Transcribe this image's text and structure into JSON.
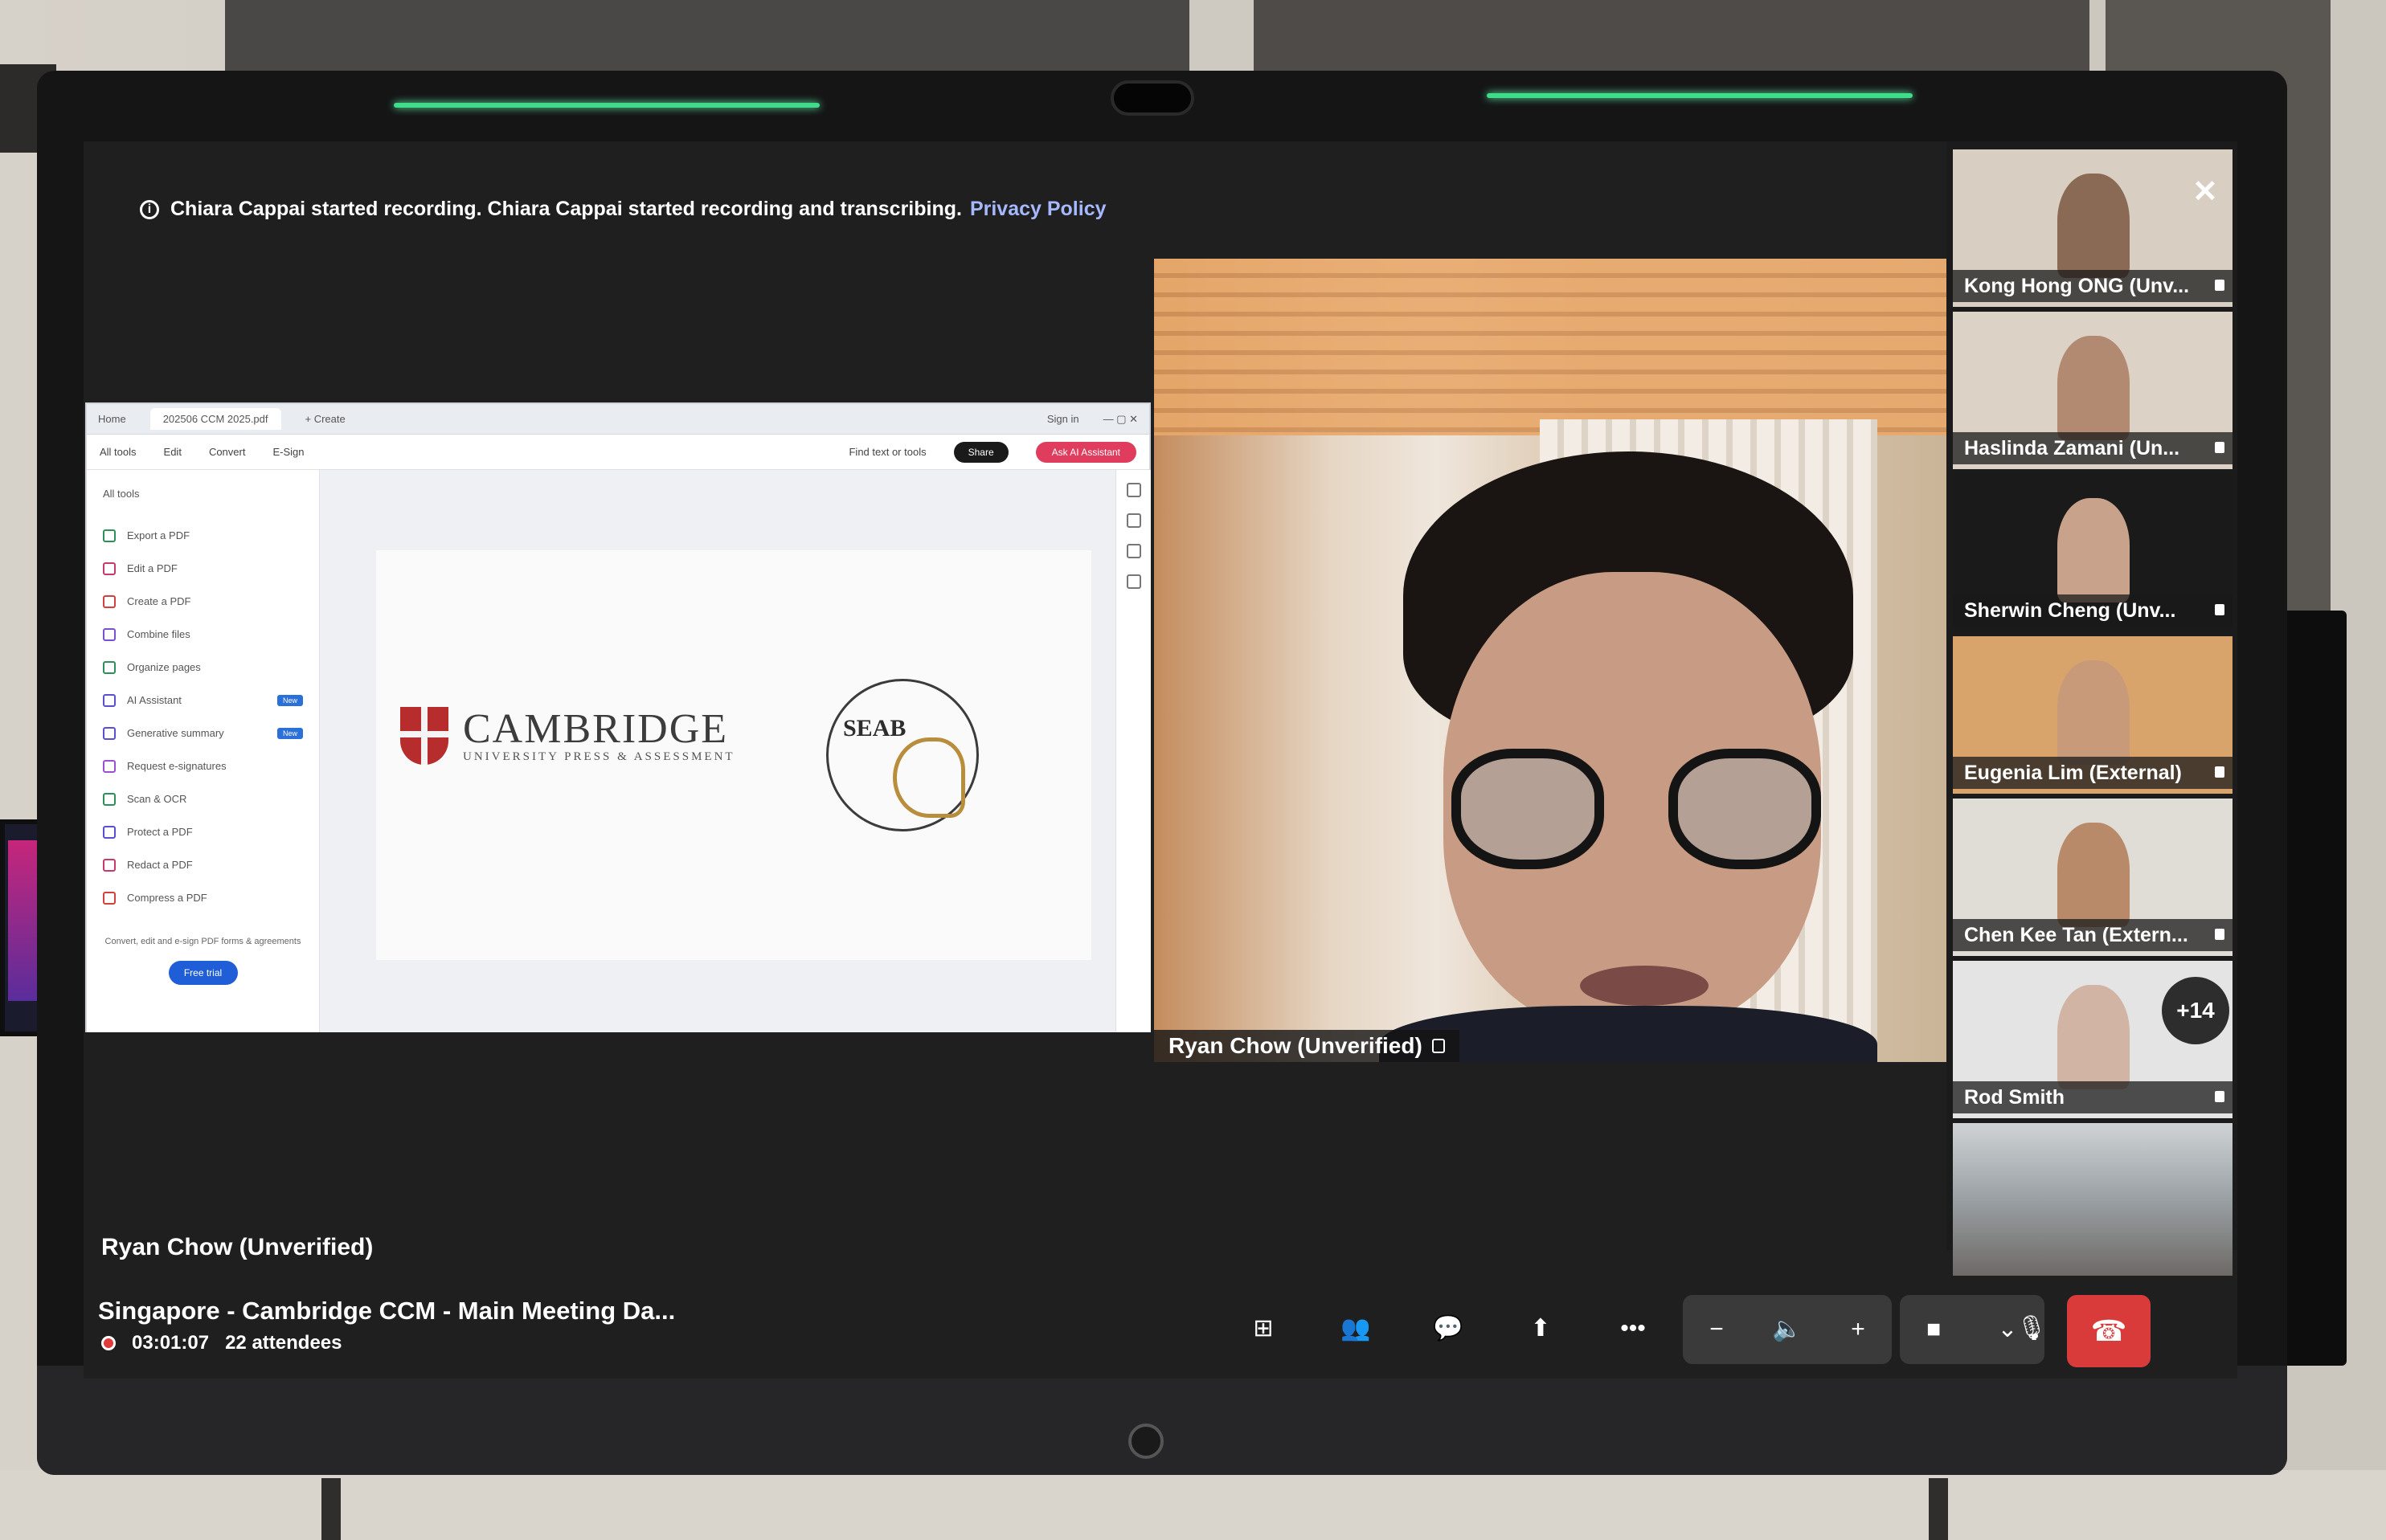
{
  "notification": {
    "text": "Chiara Cappai started recording. Chiara Cappai started recording and transcribing.",
    "link": "Privacy Policy"
  },
  "shared_app": {
    "tabs": [
      "Home",
      "202506 CCM 2025.pdf"
    ],
    "new_tab": "+ Create",
    "sign_in": "Sign in",
    "menu": [
      "All tools",
      "Edit",
      "Convert",
      "E-Sign"
    ],
    "find": "Find text or tools",
    "share_label": "Share",
    "assistant_label": "Ask AI Assistant",
    "tools_title": "All tools",
    "tools": [
      {
        "label": "Export a PDF",
        "color": "#2f8f5b"
      },
      {
        "label": "Edit a PDF",
        "color": "#c83a6b"
      },
      {
        "label": "Create a PDF",
        "color": "#d24040"
      },
      {
        "label": "Combine files",
        "color": "#7a4fd1"
      },
      {
        "label": "Organize pages",
        "color": "#2f8f5b"
      },
      {
        "label": "AI Assistant",
        "color": "#5b4fd1",
        "badge": "New"
      },
      {
        "label": "Generative summary",
        "color": "#5b4fd1",
        "badge": "New"
      },
      {
        "label": "Request e-signatures",
        "color": "#9b4fd1"
      },
      {
        "label": "Scan & OCR",
        "color": "#2f8f5b"
      },
      {
        "label": "Protect a PDF",
        "color": "#5b4fd1"
      },
      {
        "label": "Redact a PDF",
        "color": "#c83a6b"
      },
      {
        "label": "Compress a PDF",
        "color": "#d24040"
      }
    ],
    "promo": "Convert, edit and e-sign PDF forms & agreements",
    "buy_label": "Free trial",
    "doc_logo_main": "CAMBRIDGE",
    "doc_logo_sub": "UNIVERSITY PRESS & ASSESSMENT",
    "seab_text": "SEAB"
  },
  "presenter_label": "Ryan Chow (Unverified)",
  "main_video_label": "Ryan Chow (Unverified)",
  "gallery": {
    "participants": [
      {
        "name": "Kong Hong ONG (Unv...",
        "bg": "#d8cfc2",
        "skin": "#8a6a55"
      },
      {
        "name": "Haslinda Zamani (Un...",
        "bg": "#dcd2c6",
        "skin": "#b28a72"
      },
      {
        "name": "Sherwin Cheng (Unv...",
        "bg": "#1a1a1a",
        "skin": "#c8a28a"
      },
      {
        "name": "Eugenia Lim (External)",
        "bg": "#d9a46c",
        "skin": "#c89a7a"
      },
      {
        "name": "Chen Kee Tan (Extern...",
        "bg": "#e0dcd6",
        "skin": "#b88a6a"
      },
      {
        "name": "Rod Smith",
        "bg": "#e4e4e4",
        "skin": "#d2b4a4"
      }
    ],
    "more_count": "+14"
  },
  "control_bar": {
    "meeting_title": "Singapore - Cambridge CCM - Main Meeting Da...",
    "elapsed": "03:01:07",
    "attendees": "22 attendees",
    "icons": [
      "layout-icon",
      "people-icon",
      "chat-icon",
      "share-screen-icon",
      "more-icon",
      "volume-down-icon",
      "speaker-icon",
      "volume-up-icon",
      "camera-icon",
      "chevron-down-icon",
      "microphone-icon",
      "hang-up-icon"
    ]
  }
}
